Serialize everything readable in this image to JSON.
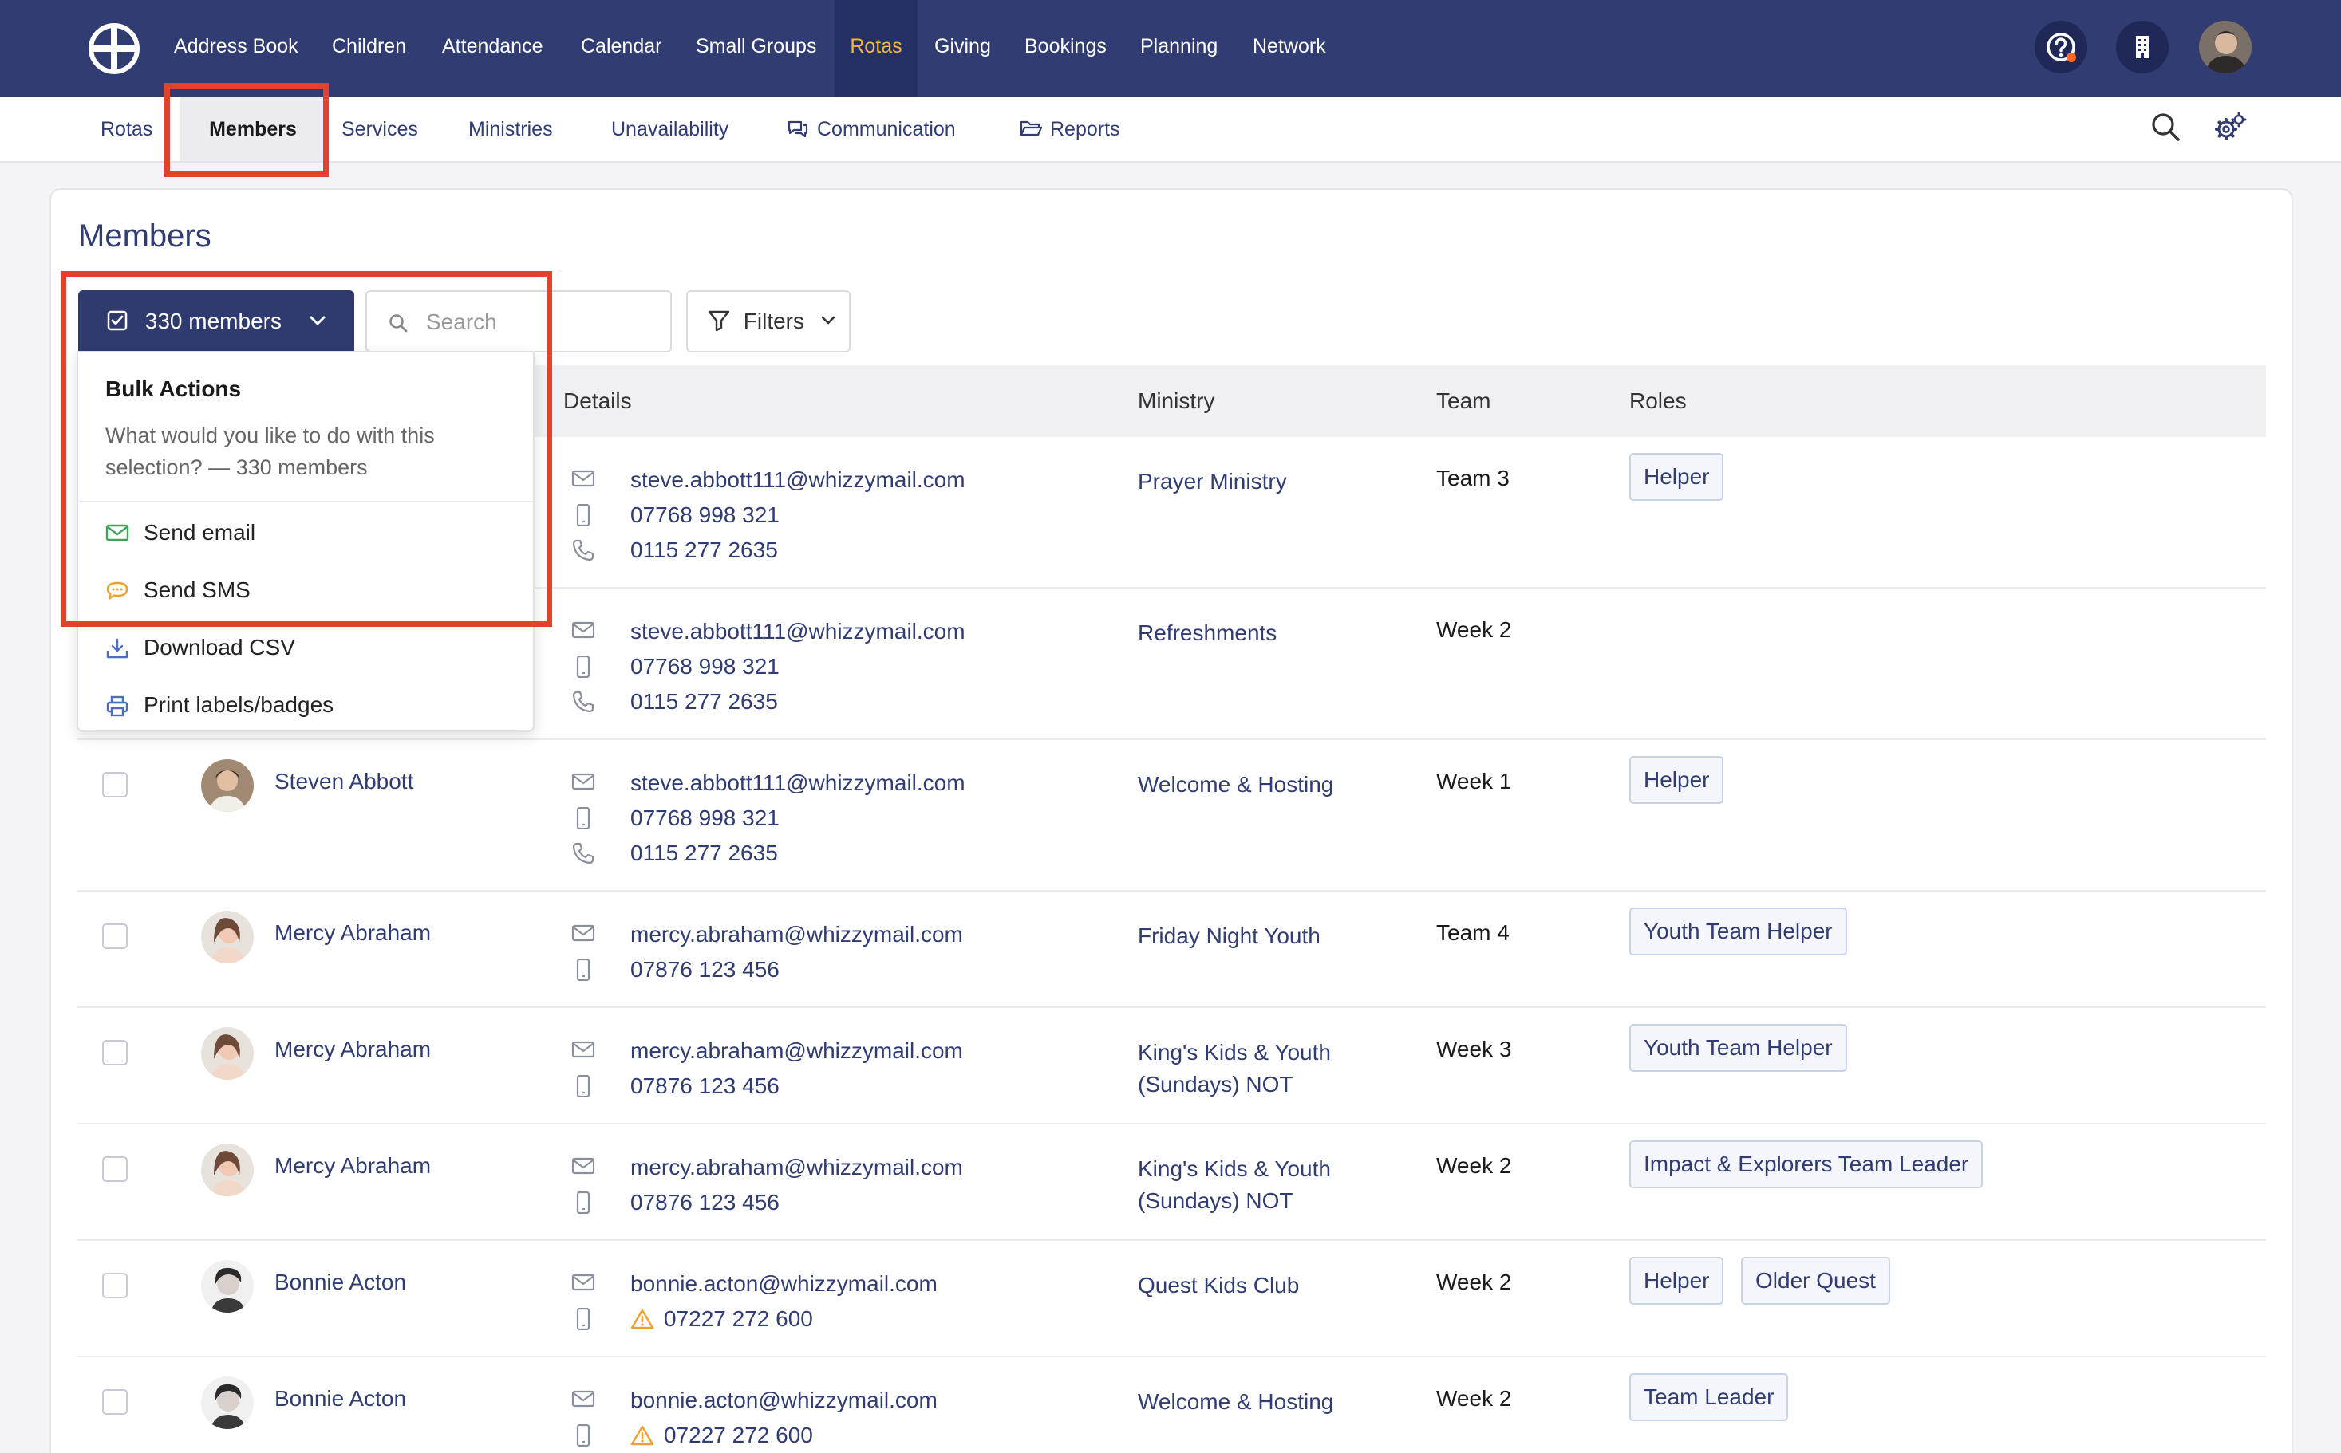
{
  "topnav": {
    "items": [
      "Address Book",
      "Children",
      "Attendance",
      "Calendar",
      "Small Groups",
      "Rotas",
      "Giving",
      "Bookings",
      "Planning",
      "Network"
    ],
    "active": "Rotas",
    "active_color": "#f4b63c"
  },
  "subnav": {
    "items": [
      "Rotas",
      "Members",
      "Services",
      "Ministries",
      "Unavailability",
      "Communication",
      "Reports"
    ],
    "active": "Members"
  },
  "page": {
    "title": "Members"
  },
  "toolbar": {
    "selection_label": "330 members",
    "search_placeholder": "Search",
    "filters_label": "Filters"
  },
  "table": {
    "headers": {
      "details": "Details",
      "ministry": "Ministry",
      "team": "Team",
      "roles": "Roles"
    },
    "rows": [
      {
        "name": "",
        "email": "steve.abbott111@whizzymail.com",
        "mobile": "07768 998 321",
        "phone": "0115 277 2635",
        "ministry": "Prayer Ministry",
        "team": "Team 3",
        "roles": [
          "Helper"
        ]
      },
      {
        "name": "",
        "email": "steve.abbott111@whizzymail.com",
        "mobile": "07768 998 321",
        "phone": "0115 277 2635",
        "ministry": "Refreshments",
        "team": "Week 2",
        "roles": []
      },
      {
        "name": "Steven Abbott",
        "email": "steve.abbott111@whizzymail.com",
        "mobile": "07768 998 321",
        "phone": "0115 277 2635",
        "ministry": "Welcome & Hosting",
        "team": "Week 1",
        "roles": [
          "Helper"
        ]
      },
      {
        "name": "Mercy Abraham",
        "email": "mercy.abraham@whizzymail.com",
        "mobile": "07876 123 456",
        "ministry": "Friday Night Youth",
        "team": "Team 4",
        "roles": [
          "Youth Team Helper"
        ]
      },
      {
        "name": "Mercy Abraham",
        "email": "mercy.abraham@whizzymail.com",
        "mobile": "07876 123 456",
        "ministry": "King's Kids & Youth (Sundays) NOT",
        "team": "Week 3",
        "roles": [
          "Youth Team Helper"
        ]
      },
      {
        "name": "Mercy Abraham",
        "email": "mercy.abraham@whizzymail.com",
        "mobile": "07876 123 456",
        "ministry": "King's Kids & Youth (Sundays) NOT",
        "team": "Week 2",
        "roles": [
          "Impact & Explorers Team Leader"
        ]
      },
      {
        "name": "Bonnie Acton",
        "email": "bonnie.acton@whizzymail.com",
        "mobile": "07227 272 600",
        "mobile_warning": true,
        "ministry": "Quest Kids Club",
        "team": "Week 2",
        "roles": [
          "Helper",
          "Older Quest"
        ]
      },
      {
        "name": "Bonnie Acton",
        "email": "bonnie.acton@whizzymail.com",
        "mobile": "07227 272 600",
        "mobile_warning": true,
        "ministry": "Welcome & Hosting",
        "team": "Week 2",
        "roles": [
          "Team Leader"
        ]
      }
    ]
  },
  "bulk_actions": {
    "title": "Bulk Actions",
    "description": "What would you like to do with this selection? — 330 members",
    "items": [
      {
        "label": "Send email",
        "icon": "envelope-icon",
        "color": "#3aa757"
      },
      {
        "label": "Send SMS",
        "icon": "chat-bubble-icon",
        "color": "#f0a030"
      },
      {
        "label": "Download CSV",
        "icon": "download-icon",
        "color": "#4a6fc0"
      },
      {
        "label": "Print labels/badges",
        "icon": "printer-icon",
        "color": "#4a6fc0"
      }
    ]
  },
  "icons": {
    "help": "help-circle-icon",
    "help_badge_color": "#ff6a2b",
    "organisation": "building-icon",
    "search": "search-icon",
    "settings": "gear-icon"
  },
  "colors": {
    "nav_bg": "#303c72",
    "primary": "#303c72",
    "highlight": "#e2412e"
  }
}
